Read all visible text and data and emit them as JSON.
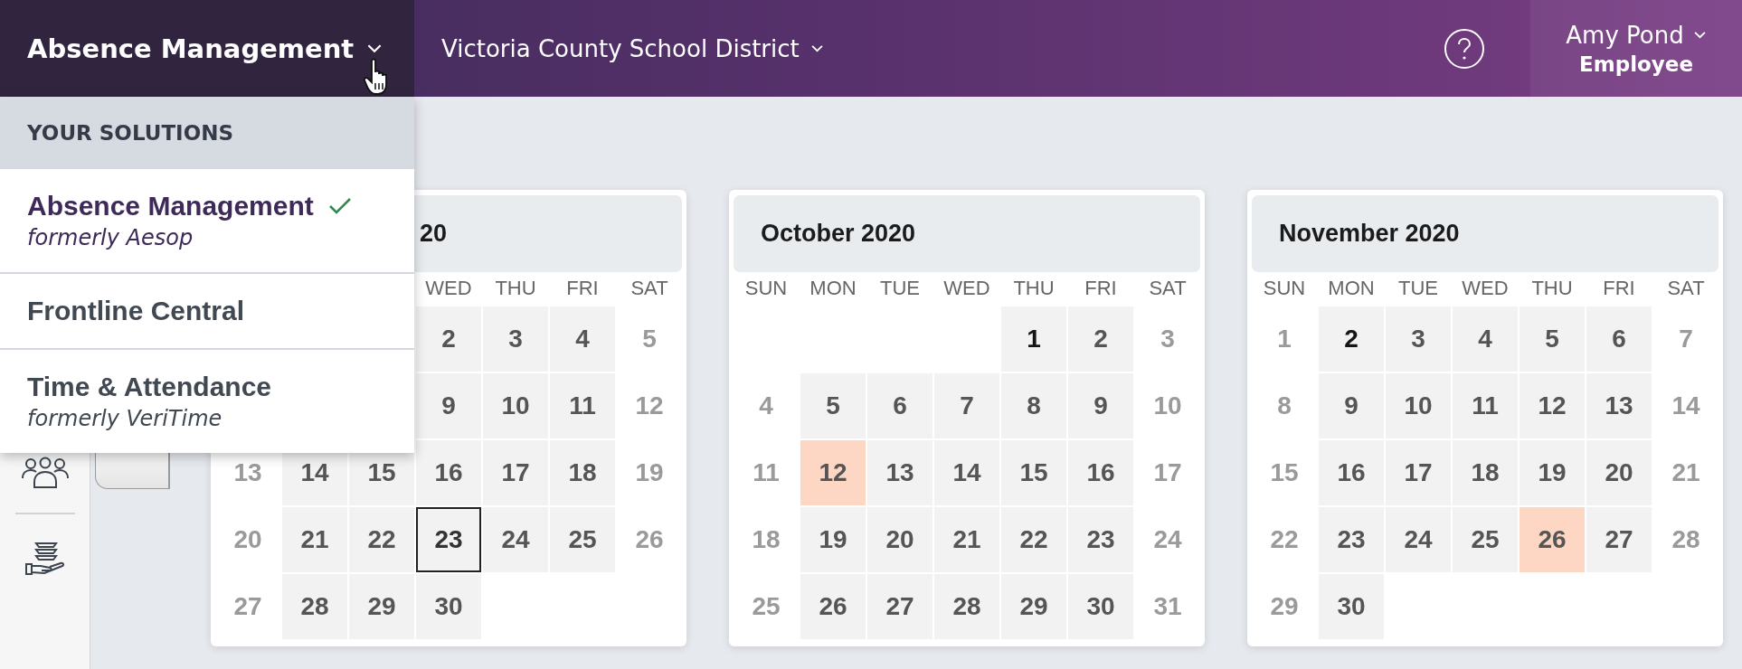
{
  "top_bar": {
    "app_switcher": {
      "label": "Absence Management",
      "expanded": true
    },
    "organization": "Victoria County School District",
    "user": {
      "name": "Amy Pond",
      "role": "Employee"
    }
  },
  "solutions_menu": {
    "heading": "YOUR SOLUTIONS",
    "items": [
      {
        "title": "Absence Management",
        "subtitle": "formerly Aesop",
        "selected": true
      },
      {
        "title": "Frontline Central",
        "selected": false
      },
      {
        "title": "Time & Attendance",
        "subtitle": "formerly VeriTime",
        "selected": false
      }
    ]
  },
  "calendars": [
    {
      "title": "20",
      "weekdays": [
        "WED",
        "THU",
        "FRI",
        "SAT"
      ],
      "weeks": [
        {
          "days": [
            {
              "n": "2",
              "kind": "weekday"
            },
            {
              "n": "3",
              "kind": "weekday"
            },
            {
              "n": "4",
              "kind": "weekday"
            },
            {
              "n": "5",
              "kind": "weekend"
            }
          ]
        },
        {
          "days": [
            {
              "n": "9",
              "kind": "weekday"
            },
            {
              "n": "10",
              "kind": "weekday"
            },
            {
              "n": "11",
              "kind": "weekday"
            },
            {
              "n": "12",
              "kind": "weekend"
            }
          ]
        },
        {
          "days": [
            {
              "n": "13",
              "kind": "weekend"
            },
            {
              "n": "14",
              "kind": "weekday"
            },
            {
              "n": "15",
              "kind": "weekday"
            },
            {
              "n": "16",
              "kind": "weekday"
            },
            {
              "n": "17",
              "kind": "weekday"
            },
            {
              "n": "18",
              "kind": "weekday"
            },
            {
              "n": "19",
              "kind": "weekend"
            }
          ]
        },
        {
          "days": [
            {
              "n": "20",
              "kind": "weekend"
            },
            {
              "n": "21",
              "kind": "weekday"
            },
            {
              "n": "22",
              "kind": "weekday"
            },
            {
              "n": "23",
              "kind": "today"
            },
            {
              "n": "24",
              "kind": "weekday"
            },
            {
              "n": "25",
              "kind": "weekday"
            },
            {
              "n": "26",
              "kind": "weekend"
            }
          ]
        },
        {
          "days": [
            {
              "n": "27",
              "kind": "weekend"
            },
            {
              "n": "28",
              "kind": "weekday"
            },
            {
              "n": "29",
              "kind": "weekday"
            },
            {
              "n": "30",
              "kind": "weekday"
            }
          ]
        }
      ]
    },
    {
      "title": "October 2020",
      "weekdays": [
        "SUN",
        "MON",
        "TUE",
        "WED",
        "THU",
        "FRI",
        "SAT"
      ],
      "weeks": [
        {
          "days": [
            {
              "n": "1",
              "kind": "first"
            },
            {
              "n": "2",
              "kind": "weekday"
            },
            {
              "n": "3",
              "kind": "weekend"
            }
          ]
        },
        {
          "days": [
            {
              "n": "4",
              "kind": "weekend"
            },
            {
              "n": "5",
              "kind": "weekday"
            },
            {
              "n": "6",
              "kind": "weekday"
            },
            {
              "n": "7",
              "kind": "weekday"
            },
            {
              "n": "8",
              "kind": "weekday"
            },
            {
              "n": "9",
              "kind": "weekday"
            },
            {
              "n": "10",
              "kind": "weekend"
            }
          ]
        },
        {
          "days": [
            {
              "n": "11",
              "kind": "weekend"
            },
            {
              "n": "12",
              "kind": "absence"
            },
            {
              "n": "13",
              "kind": "weekday"
            },
            {
              "n": "14",
              "kind": "weekday"
            },
            {
              "n": "15",
              "kind": "weekday"
            },
            {
              "n": "16",
              "kind": "weekday"
            },
            {
              "n": "17",
              "kind": "weekend"
            }
          ]
        },
        {
          "days": [
            {
              "n": "18",
              "kind": "weekend"
            },
            {
              "n": "19",
              "kind": "weekday"
            },
            {
              "n": "20",
              "kind": "weekday"
            },
            {
              "n": "21",
              "kind": "weekday"
            },
            {
              "n": "22",
              "kind": "weekday"
            },
            {
              "n": "23",
              "kind": "weekday"
            },
            {
              "n": "24",
              "kind": "weekend"
            }
          ]
        },
        {
          "days": [
            {
              "n": "25",
              "kind": "weekend"
            },
            {
              "n": "26",
              "kind": "weekday"
            },
            {
              "n": "27",
              "kind": "weekday"
            },
            {
              "n": "28",
              "kind": "weekday"
            },
            {
              "n": "29",
              "kind": "weekday"
            },
            {
              "n": "30",
              "kind": "weekday"
            },
            {
              "n": "31",
              "kind": "weekend"
            }
          ]
        }
      ]
    },
    {
      "title": "November 2020",
      "weekdays": [
        "SUN",
        "MON",
        "TUE",
        "WED",
        "THU",
        "FRI",
        "SAT"
      ],
      "weeks": [
        {
          "days": [
            {
              "n": "1",
              "kind": "weekend"
            },
            {
              "n": "2",
              "kind": "first"
            },
            {
              "n": "3",
              "kind": "weekday"
            },
            {
              "n": "4",
              "kind": "weekday"
            },
            {
              "n": "5",
              "kind": "weekday"
            },
            {
              "n": "6",
              "kind": "weekday"
            },
            {
              "n": "7",
              "kind": "weekend"
            }
          ]
        },
        {
          "days": [
            {
              "n": "8",
              "kind": "weekend"
            },
            {
              "n": "9",
              "kind": "weekday"
            },
            {
              "n": "10",
              "kind": "weekday"
            },
            {
              "n": "11",
              "kind": "weekday"
            },
            {
              "n": "12",
              "kind": "weekday"
            },
            {
              "n": "13",
              "kind": "weekday"
            },
            {
              "n": "14",
              "kind": "weekend"
            }
          ]
        },
        {
          "days": [
            {
              "n": "15",
              "kind": "weekend"
            },
            {
              "n": "16",
              "kind": "weekday"
            },
            {
              "n": "17",
              "kind": "weekday"
            },
            {
              "n": "18",
              "kind": "weekday"
            },
            {
              "n": "19",
              "kind": "weekday"
            },
            {
              "n": "20",
              "kind": "weekday"
            },
            {
              "n": "21",
              "kind": "weekend"
            }
          ]
        },
        {
          "days": [
            {
              "n": "22",
              "kind": "weekend"
            },
            {
              "n": "23",
              "kind": "weekday"
            },
            {
              "n": "24",
              "kind": "weekday"
            },
            {
              "n": "25",
              "kind": "weekday"
            },
            {
              "n": "26",
              "kind": "absence"
            },
            {
              "n": "27",
              "kind": "weekday"
            },
            {
              "n": "28",
              "kind": "weekend"
            }
          ]
        },
        {
          "days": [
            {
              "n": "29",
              "kind": "weekend"
            },
            {
              "n": "30",
              "kind": "weekday"
            }
          ]
        }
      ]
    }
  ]
}
